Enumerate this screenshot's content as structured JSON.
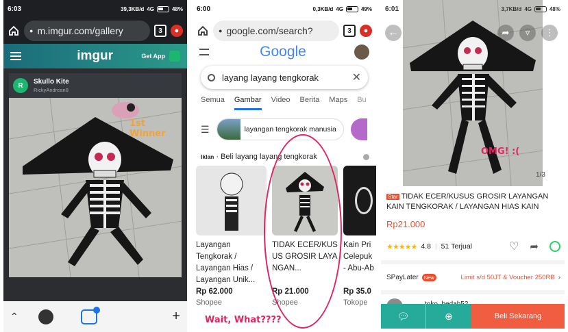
{
  "imgur": {
    "time": "6:03",
    "net": "39,3KB/d",
    "sig": "4G",
    "batt": "48%",
    "url": "m.imgur.com/gallery",
    "tabs": "3",
    "brand": "imgur",
    "getapp": "Get App",
    "title": "Skullo Kite",
    "user": "RickyAndrean8",
    "avatar_letter": "R",
    "annotation": "1st Winner"
  },
  "google": {
    "time": "6:00",
    "net": "0,3KB/d",
    "sig": "4G",
    "batt": "49%",
    "url": "google.com/search?",
    "tabs": "3",
    "logo": "Google",
    "query": "layang layang tengkorak",
    "tabs_list": [
      "Semua",
      "Gambar",
      "Video",
      "Berita",
      "Maps",
      "Bu"
    ],
    "suggest": "layangan tengkorak manusia",
    "ads_tag": "Iklan",
    "ads_title": "· Beli layang layang tengkorak",
    "products": [
      {
        "name": "Layangan Tengkorak / Layangan Hias / Layangan Unik...",
        "price": "Rp 62.000",
        "store": "Shopee"
      },
      {
        "name": "TIDAK ECER/KUSUS GROSIR LAYANGAN...",
        "price": "Rp 21.000",
        "store": "Shopee"
      },
      {
        "name": "Kain Pri Celepuk - Abu-Ab",
        "price": "Rp 35.0",
        "store": "Tokope"
      }
    ],
    "annotation": "Wait, What????"
  },
  "shopee": {
    "time": "6:01",
    "net": "3,7KB/d",
    "sig": "4G",
    "batt": "48%",
    "annotation": "OMG! :(",
    "counter": "1/3",
    "star_badge": "Star",
    "title": "TIDAK ECER/KUSUS GROSIR LAYANGAN KAIN TENGKORAK / LAYANGAN HIAS KAIN",
    "price": "Rp21.000",
    "rating": "4.8",
    "sold": "51 Terjual",
    "spay": "SPayLater",
    "spay_badge": "New",
    "spay_limit": "Limit s/d 50JT & Voucher 250RB",
    "shop": "toko_bedah52",
    "buy": "Beli Sekarang",
    "rating_stars": 4.8
  },
  "colors": {
    "imgur_green": "#1bb76e",
    "shopee_orange": "#ee4d2d",
    "annotation_red": "#e0245e",
    "buy_red": "#f05d40",
    "chat_teal": "#26aa99"
  }
}
